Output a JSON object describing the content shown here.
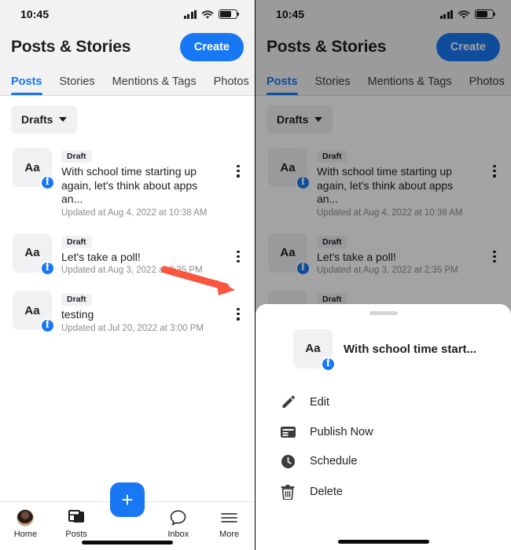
{
  "status_bar": {
    "time": "10:45",
    "signal_icon": "cellular-signal-icon",
    "wifi_icon": "wifi-icon",
    "battery_icon": "battery-icon"
  },
  "header": {
    "title": "Posts & Stories",
    "create_label": "Create"
  },
  "tabs": [
    {
      "label": "Posts",
      "active": true
    },
    {
      "label": "Stories",
      "active": false
    },
    {
      "label": "Mentions & Tags",
      "active": false
    },
    {
      "label": "Photos",
      "active": false
    }
  ],
  "filter": {
    "label": "Drafts",
    "icon": "chevron-down-icon"
  },
  "drafts": [
    {
      "badge": "Draft",
      "title": "With school time starting up again, let's think about apps an...",
      "meta": "Updated at Aug 4, 2022 at 10:38 AM",
      "thumb_label": "Aa",
      "platform_icon": "facebook-badge-icon"
    },
    {
      "badge": "Draft",
      "title": "Let's take a poll!",
      "meta": "Updated at Aug 3, 2022 at 2:35 PM",
      "thumb_label": "Aa",
      "platform_icon": "facebook-badge-icon"
    },
    {
      "badge": "Draft",
      "title": "testing",
      "meta": "Updated at Jul 20, 2022 at 3:00 PM",
      "thumb_label": "Aa",
      "platform_icon": "facebook-badge-icon"
    }
  ],
  "bottom_nav": {
    "fab_label": "+",
    "items": [
      {
        "label": "Home",
        "icon": "avatar-icon"
      },
      {
        "label": "Posts",
        "icon": "posts-icon"
      },
      {
        "label": "Inbox",
        "icon": "chat-bubble-icon"
      },
      {
        "label": "More",
        "icon": "hamburger-icon"
      }
    ]
  },
  "annotation": {
    "arrow_color": "#f9553f",
    "arrow_icon": "red-arrow-pointer"
  },
  "sheet": {
    "grabber_icon": "drag-handle-icon",
    "post_title": "With school time start...",
    "thumb_label": "Aa",
    "platform_icon": "facebook-badge-icon",
    "menu": [
      {
        "label": "Edit",
        "icon": "pencil-icon"
      },
      {
        "label": "Publish Now",
        "icon": "publish-icon"
      },
      {
        "label": "Schedule",
        "icon": "clock-icon"
      },
      {
        "label": "Delete",
        "icon": "trash-icon"
      }
    ]
  },
  "colors": {
    "accent": "#1877f2",
    "arrow": "#f9553f",
    "header_bg": "#f2f2f2",
    "muted_text": "#8a8d91"
  }
}
